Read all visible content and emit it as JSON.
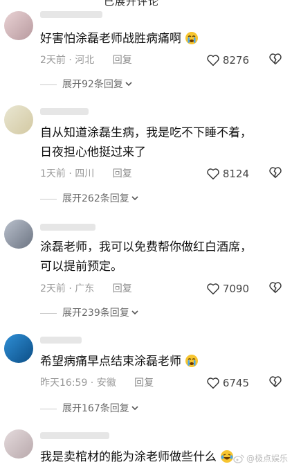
{
  "top_partial_text": "已展开评论",
  "comments": [
    {
      "text_lines": [
        "好害怕涂磊老师战胜病痛啊"
      ],
      "emoji": "crying-face-emoji",
      "time": "2天前",
      "location": "河北",
      "reply_label": "回复",
      "likes": "8276",
      "expand_label": "展开92条回复"
    },
    {
      "text_lines": [
        "自从知道涂磊生病，我是吃不下睡不着，",
        "日夜担心他挺过来了"
      ],
      "emoji": "",
      "time": "1天前",
      "location": "四川",
      "reply_label": "回复",
      "likes": "8124",
      "expand_label": "展开262条回复"
    },
    {
      "text_lines": [
        "涂磊老师，我可以免费帮你做红白酒席，",
        "可以提前预定。"
      ],
      "emoji": "",
      "time": "2天前",
      "location": "广东",
      "reply_label": "回复",
      "likes": "7090",
      "expand_label": "展开239条回复"
    },
    {
      "text_lines": [
        "希望病痛早点结束涂磊老师"
      ],
      "emoji": "crying-face-emoji",
      "time": "昨天16:59",
      "location": "安徽",
      "reply_label": "回复",
      "likes": "6745",
      "expand_label": "展开167条回复"
    },
    {
      "text_lines": [
        "我是卖棺材的能为涂老师做些什么"
      ],
      "emoji": "laughing-tears-emoji",
      "time": "",
      "location": "",
      "reply_label": "",
      "likes": "",
      "expand_label": ""
    }
  ],
  "watermark": "@极点娱乐"
}
